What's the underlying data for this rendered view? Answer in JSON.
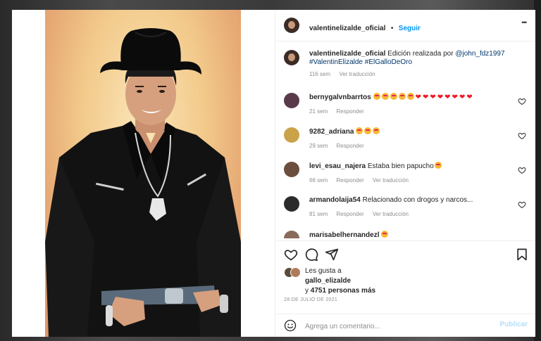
{
  "post": {
    "username": "valentinelizalde_oficial",
    "separator": "•",
    "follow": "Seguir",
    "more": "•••"
  },
  "caption": {
    "username": "valentinelizalde_oficial",
    "text": "Edición realizada por",
    "mention": "@john_fdz1997",
    "hashtags": "#ValentinElizalde #ElGalloDeOro",
    "time": "116 sem",
    "translate": "Ver traducción"
  },
  "comments": [
    {
      "username": "bernygalvnbarrtos",
      "text": "",
      "emojis": 5,
      "hearts": 8,
      "time": "21 sem",
      "reply": "Responder",
      "translate": ""
    },
    {
      "username": "9282_adriana",
      "text": "",
      "emojis": 3,
      "hearts": 0,
      "time": "29 sem",
      "reply": "Responder",
      "translate": ""
    },
    {
      "username": "levi_esau_najera",
      "text": "Estaba bien papucho",
      "emojis": 1,
      "hearts": 0,
      "time": "66 sem",
      "reply": "Responder",
      "translate": "Ver traducción"
    },
    {
      "username": "armandolaija54",
      "text": "Relacionado con drogos y narcos...",
      "emojis": 0,
      "hearts": 0,
      "time": "81 sem",
      "reply": "Responder",
      "translate": "Ver traducción"
    },
    {
      "username": "marisabelhernandezl",
      "text": "",
      "emojis": 1,
      "hearts": 0,
      "time": "",
      "reply": "",
      "translate": ""
    }
  ],
  "likes": {
    "line1": "Les gusta a",
    "user": "gallo_elizalde",
    "line3_prefix": "y",
    "count": "4751 personas más"
  },
  "date": "28 DE JULIO DE 2021",
  "add_comment": {
    "placeholder": "Agrega un comentario...",
    "publish": "Publicar"
  },
  "icons": {
    "like": "heart-icon",
    "comment": "comment-icon",
    "share": "share-icon",
    "save": "bookmark-icon",
    "emoji": "emoji-icon"
  }
}
